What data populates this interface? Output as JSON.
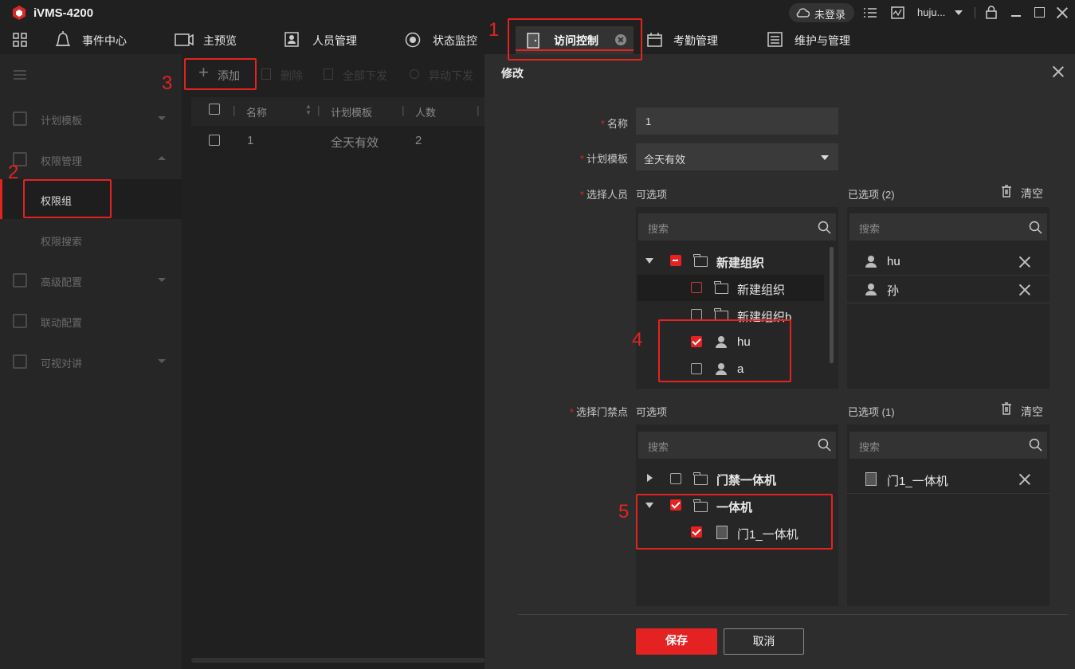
{
  "app": {
    "title": "iVMS-4200"
  },
  "titlebar": {
    "login_status": "未登录",
    "user": "huju..."
  },
  "tabs": [
    {
      "label": "事件中心"
    },
    {
      "label": "主预览"
    },
    {
      "label": "人员管理"
    },
    {
      "label": "状态监控"
    },
    {
      "label": "访问控制"
    },
    {
      "label": "考勤管理"
    },
    {
      "label": "维护与管理"
    }
  ],
  "sidebar": {
    "items": [
      {
        "label": "计划模板"
      },
      {
        "label": "权限管理"
      },
      {
        "label": "权限组"
      },
      {
        "label": "权限搜索"
      },
      {
        "label": "高级配置"
      },
      {
        "label": "联动配置"
      },
      {
        "label": "可视对讲"
      }
    ]
  },
  "toolbar": {
    "add": "添加",
    "delete": "删除",
    "all_deploy": "全部下发",
    "diff_deploy": "异动下发"
  },
  "table": {
    "headers": [
      "名称",
      "计划模板",
      "人数"
    ],
    "rows": [
      {
        "name": "1",
        "template": "全天有效",
        "count": "2"
      }
    ]
  },
  "dialog": {
    "title": "修改",
    "name_label": "名称",
    "name_value": "1",
    "template_label": "计划模板",
    "template_value": "全天有效",
    "person_label": "选择人员",
    "available_label": "可选项",
    "selected_person_label": "已选项",
    "selected_person_count": "(2)",
    "clear_label": "清空",
    "search_placeholder": "搜索",
    "person_tree": [
      {
        "label": "新建组织"
      },
      {
        "label": "新建组织"
      },
      {
        "label": "新建组织b"
      },
      {
        "label": "hu"
      },
      {
        "label": "a"
      }
    ],
    "selected_persons": [
      {
        "label": "hu"
      },
      {
        "label": "孙"
      }
    ],
    "door_label": "选择门禁点",
    "selected_door_count": "(1)",
    "door_tree": [
      {
        "label": "门禁一体机"
      },
      {
        "label": "一体机"
      },
      {
        "label": "门1_一体机"
      }
    ],
    "selected_doors": [
      {
        "label": "门1_一体机"
      }
    ],
    "save": "保存",
    "cancel": "取消"
  },
  "annotations": [
    "1",
    "2",
    "3",
    "4",
    "5"
  ],
  "colors": {
    "accent": "#e52222",
    "bg": "#1f1f1f",
    "dialog": "#2d2d2d"
  }
}
